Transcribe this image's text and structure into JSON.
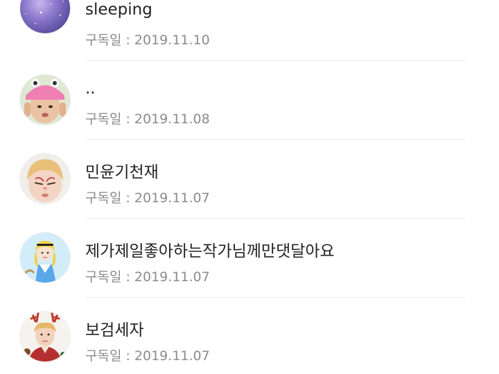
{
  "subscribers": [
    {
      "name": "sleeping",
      "date": "구독일 : 2019.11.10",
      "avatar": "galaxy-avatar-icon"
    },
    {
      "name": "..",
      "date": "구독일 : 2019.11.08",
      "avatar": "pink-hat-person-avatar-icon"
    },
    {
      "name": "민윤기천재",
      "date": "구독일 : 2019.11.07",
      "avatar": "blond-person-avatar-icon"
    },
    {
      "name": "제가제일좋아하는작가님께만댓달아요",
      "date": "구독일 : 2019.11.07",
      "avatar": "alice-cartoon-avatar-icon"
    },
    {
      "name": "보검세자",
      "date": "구독일 : 2019.11.07",
      "avatar": "antlers-person-avatar-icon"
    }
  ],
  "colors": {
    "name_text": "#222222",
    "date_text": "#8b8b8b",
    "divider": "#ebebeb"
  }
}
